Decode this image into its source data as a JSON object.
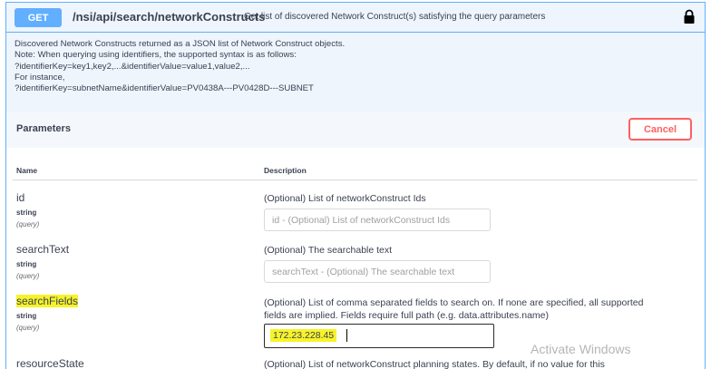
{
  "operation": {
    "method": "GET",
    "path": "/nsi/api/search/networkConstructs",
    "summary": "Get list of discovered Network Construct(s) satisfying the query parameters",
    "description_lines": [
      "Discovered Network Constructs returned as a JSON list of Network Construct objects.",
      "Note: When querying using identifiers, the supported syntax is as follows:",
      "?identifierKey=key1,key2,...&identifierValue=value1,value2,...",
      "For instance,",
      "?identifierKey=subnetName&identifierValue=PV0438A---PV0428D---SUBNET"
    ]
  },
  "parameters_section": {
    "title": "Parameters",
    "cancel_label": "Cancel",
    "col_name": "Name",
    "col_description": "Description"
  },
  "params": [
    {
      "name": "id",
      "type": "string",
      "in": "(query)",
      "description": "(Optional) List of networkConstruct Ids",
      "placeholder": "id - (Optional) List of networkConstruct Ids",
      "value": ""
    },
    {
      "name": "searchText",
      "type": "string",
      "in": "(query)",
      "description": "(Optional) The searchable text",
      "placeholder": "searchText - (Optional) The searchable text",
      "value": ""
    },
    {
      "name": "searchFields",
      "type": "string",
      "in": "(query)",
      "description_line1": "(Optional) List of comma separated fields to search on. If none are specified, all supported",
      "description_line2": "fields are implied. Fields require full path (e.g. data.attributes.name)",
      "value": "172.23.228.45"
    },
    {
      "name": "resourceState",
      "description": "(Optional) List of networkConstruct planning states. By default, if no value for this"
    }
  ],
  "watermark": "Activate Windows",
  "colors": {
    "get_blue": "#61affe",
    "cancel_red": "#ff6060",
    "highlight_yellow": "#f7f32a"
  },
  "icons": {
    "lock": "lock-icon"
  }
}
